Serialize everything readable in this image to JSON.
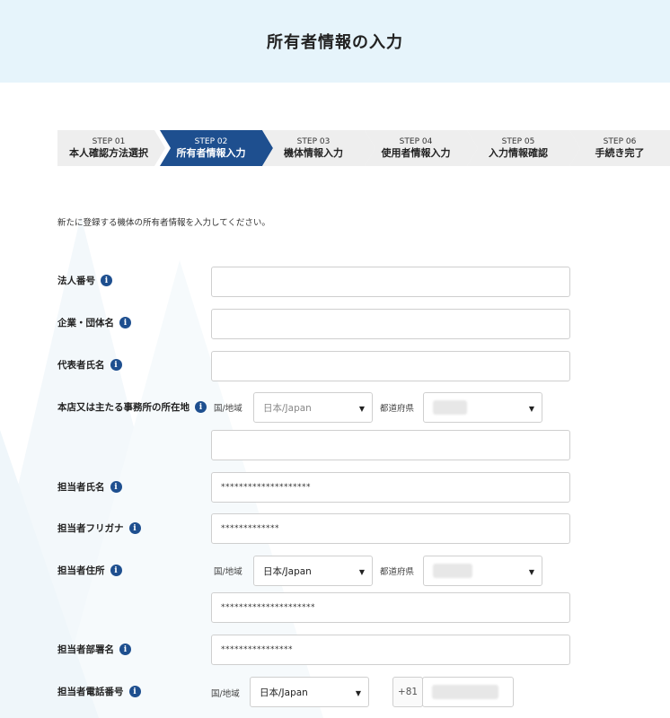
{
  "header": {
    "title": "所有者情報の入力"
  },
  "steps": [
    {
      "num": "STEP 01",
      "label": "本人確認方法選択",
      "active": false
    },
    {
      "num": "STEP 02",
      "label": "所有者情報入力",
      "active": true
    },
    {
      "num": "STEP 03",
      "label": "機体情報入力",
      "active": false
    },
    {
      "num": "STEP 04",
      "label": "使用者情報入力",
      "active": false
    },
    {
      "num": "STEP 05",
      "label": "入力情報確認",
      "active": false
    },
    {
      "num": "STEP 06",
      "label": "手続き完了",
      "active": false
    }
  ],
  "intro": "新たに登録する機体の所有者情報を入力してください。",
  "colors": {
    "accent": "#1e4f8f",
    "header_bg": "#e6f4fb",
    "step_bg": "#eeeeee"
  },
  "form": {
    "corporate_number": {
      "label": "法人番号",
      "value": ""
    },
    "company_name": {
      "label": "企業・団体名",
      "value": ""
    },
    "representative_name": {
      "label": "代表者氏名",
      "value": ""
    },
    "head_office": {
      "label": "本店又は主たる事務所の所在地",
      "country_label": "国/地域",
      "country_value": "日本/Japan",
      "prefecture_label": "都道府県",
      "address_value": ""
    },
    "contact_name": {
      "label": "担当者氏名",
      "value": "********************"
    },
    "contact_kana": {
      "label": "担当者フリガナ",
      "value": "*************"
    },
    "contact_address": {
      "label": "担当者住所",
      "country_label": "国/地域",
      "country_value": "日本/Japan",
      "prefecture_label": "都道府県",
      "address_value": "*********************"
    },
    "contact_department": {
      "label": "担当者部署名",
      "value": "****************"
    },
    "contact_phone": {
      "label": "担当者電話番号",
      "country_label": "国/地域",
      "country_value": "日本/Japan",
      "prefix": "+81"
    }
  }
}
